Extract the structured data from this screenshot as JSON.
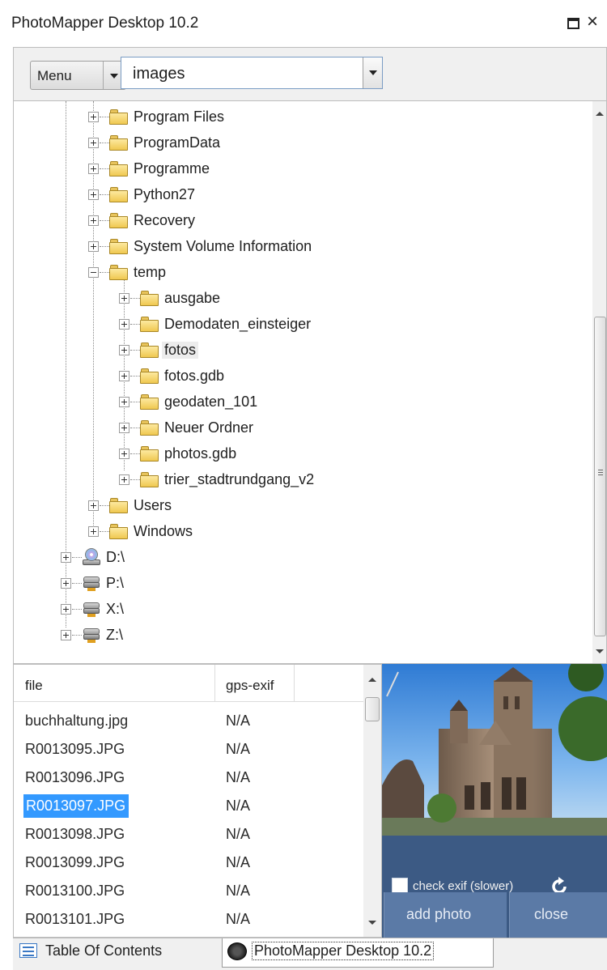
{
  "window": {
    "title": "PhotoMapper Desktop 10.2",
    "maximize_icon": "maximize-icon",
    "close_glyph": "×"
  },
  "toolbar": {
    "menu_label": "Menu",
    "path_value": "images"
  },
  "tree": {
    "nodes": [
      {
        "label": "Program Files",
        "expander": "plus",
        "icon": "folder"
      },
      {
        "label": "ProgramData",
        "expander": "plus",
        "icon": "folder"
      },
      {
        "label": "Programme",
        "expander": "plus",
        "icon": "folder"
      },
      {
        "label": "Python27",
        "expander": "plus",
        "icon": "folder"
      },
      {
        "label": "Recovery",
        "expander": "plus",
        "icon": "folder"
      },
      {
        "label": "System Volume Information",
        "expander": "plus",
        "icon": "folder"
      },
      {
        "label": "temp",
        "expander": "minus",
        "icon": "folder"
      },
      {
        "label": "ausgabe",
        "expander": "plus",
        "icon": "folder"
      },
      {
        "label": "Demodaten_einsteiger",
        "expander": "plus",
        "icon": "folder"
      },
      {
        "label": "fotos",
        "expander": "plus",
        "icon": "folder",
        "selected": true
      },
      {
        "label": "fotos.gdb",
        "expander": "plus",
        "icon": "folder"
      },
      {
        "label": "geodaten_101",
        "expander": "plus",
        "icon": "folder"
      },
      {
        "label": "Neuer Ordner",
        "expander": "plus",
        "icon": "folder"
      },
      {
        "label": "photos.gdb",
        "expander": "plus",
        "icon": "folder"
      },
      {
        "label": "trier_stadtrundgang_v2",
        "expander": "plus",
        "icon": "folder"
      },
      {
        "label": "Users",
        "expander": "plus",
        "icon": "folder"
      },
      {
        "label": "Windows",
        "expander": "plus",
        "icon": "folder"
      },
      {
        "label": "D:\\",
        "expander": "plus",
        "icon": "cd-drive"
      },
      {
        "label": "P:\\",
        "expander": "plus",
        "icon": "network-drive"
      },
      {
        "label": "X:\\",
        "expander": "plus",
        "icon": "network-drive"
      },
      {
        "label": "Z:\\",
        "expander": "plus",
        "icon": "network-drive"
      }
    ]
  },
  "filelist": {
    "columns": [
      "file",
      "gps-exif"
    ],
    "rows": [
      {
        "file": "buchhaltung.jpg",
        "gps": "N/A"
      },
      {
        "file": "R0013095.JPG",
        "gps": "N/A"
      },
      {
        "file": "R0013096.JPG",
        "gps": "N/A"
      },
      {
        "file": "R0013097.JPG",
        "gps": "N/A",
        "selected": true
      },
      {
        "file": "R0013098.JPG",
        "gps": "N/A"
      },
      {
        "file": "R0013099.JPG",
        "gps": "N/A"
      },
      {
        "file": "R0013100.JPG",
        "gps": "N/A"
      },
      {
        "file": "R0013101.JPG",
        "gps": "N/A"
      }
    ]
  },
  "preview": {
    "check_exif_label": "check exif (slower)",
    "check_exif_checked": false,
    "refresh_icon": "refresh-icon",
    "add_photo_label": "add photo",
    "close_label": "close"
  },
  "tabs": [
    {
      "label": "Table Of Contents",
      "icon": "table-of-contents-icon",
      "active": false
    },
    {
      "label": "PhotoMapper Desktop 10.2",
      "icon": "photomapper-icon",
      "active": true
    }
  ],
  "colors": {
    "selection": "#3399ff",
    "preview_panel": "#3c5a84",
    "button": "#5b7aa6",
    "folder": "#f0c850"
  }
}
